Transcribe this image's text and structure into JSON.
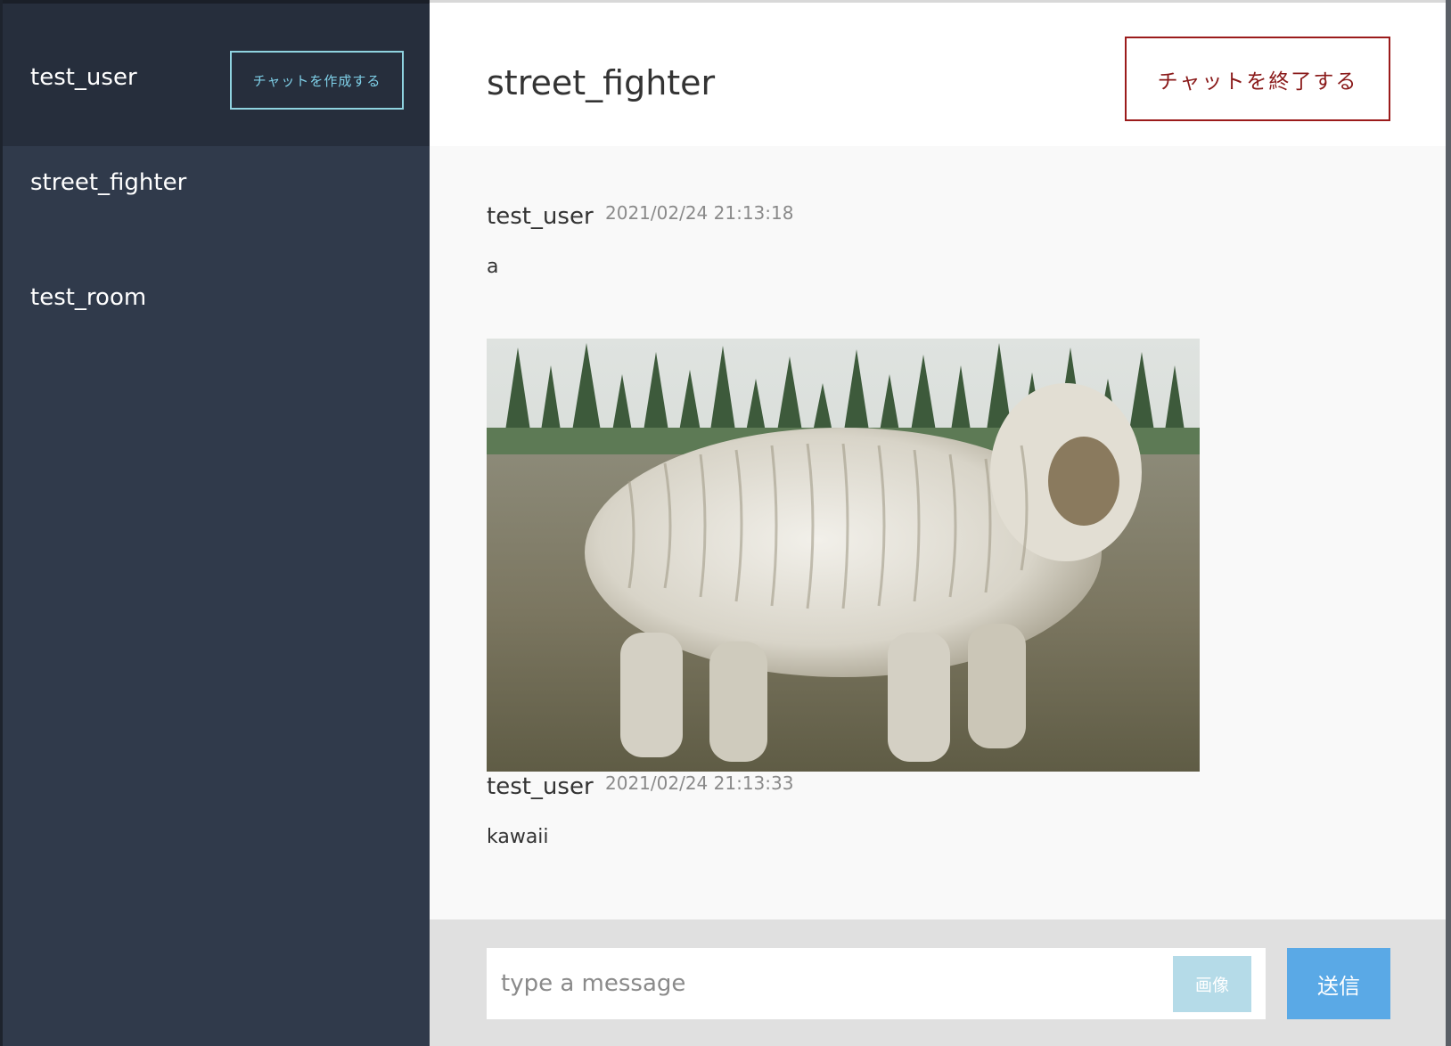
{
  "sidebar": {
    "current_user": "test_user",
    "create_chat_label": "チャットを作成する",
    "rooms": [
      {
        "label": "street_fighter"
      },
      {
        "label": "test_room"
      }
    ]
  },
  "header": {
    "room_title": "street_fighter",
    "end_chat_label": "チャットを終了する"
  },
  "messages": [
    {
      "user": "test_user",
      "time": "2021/02/24 21:13:18",
      "text": "a"
    },
    {
      "user": "test_user",
      "time": "2021/02/24 21:13:33",
      "text": "kawaii"
    }
  ],
  "composer": {
    "placeholder": "type a message",
    "image_label": "画像",
    "send_label": "送信"
  },
  "colors": {
    "sidebar_bg": "#303a4b",
    "sidebar_header_bg": "#262e3c",
    "create_button_border": "#8fd3e0",
    "end_button_border": "#9b1b1b",
    "send_button": "#5aa9e6",
    "image_button": "#b5dbe8"
  }
}
